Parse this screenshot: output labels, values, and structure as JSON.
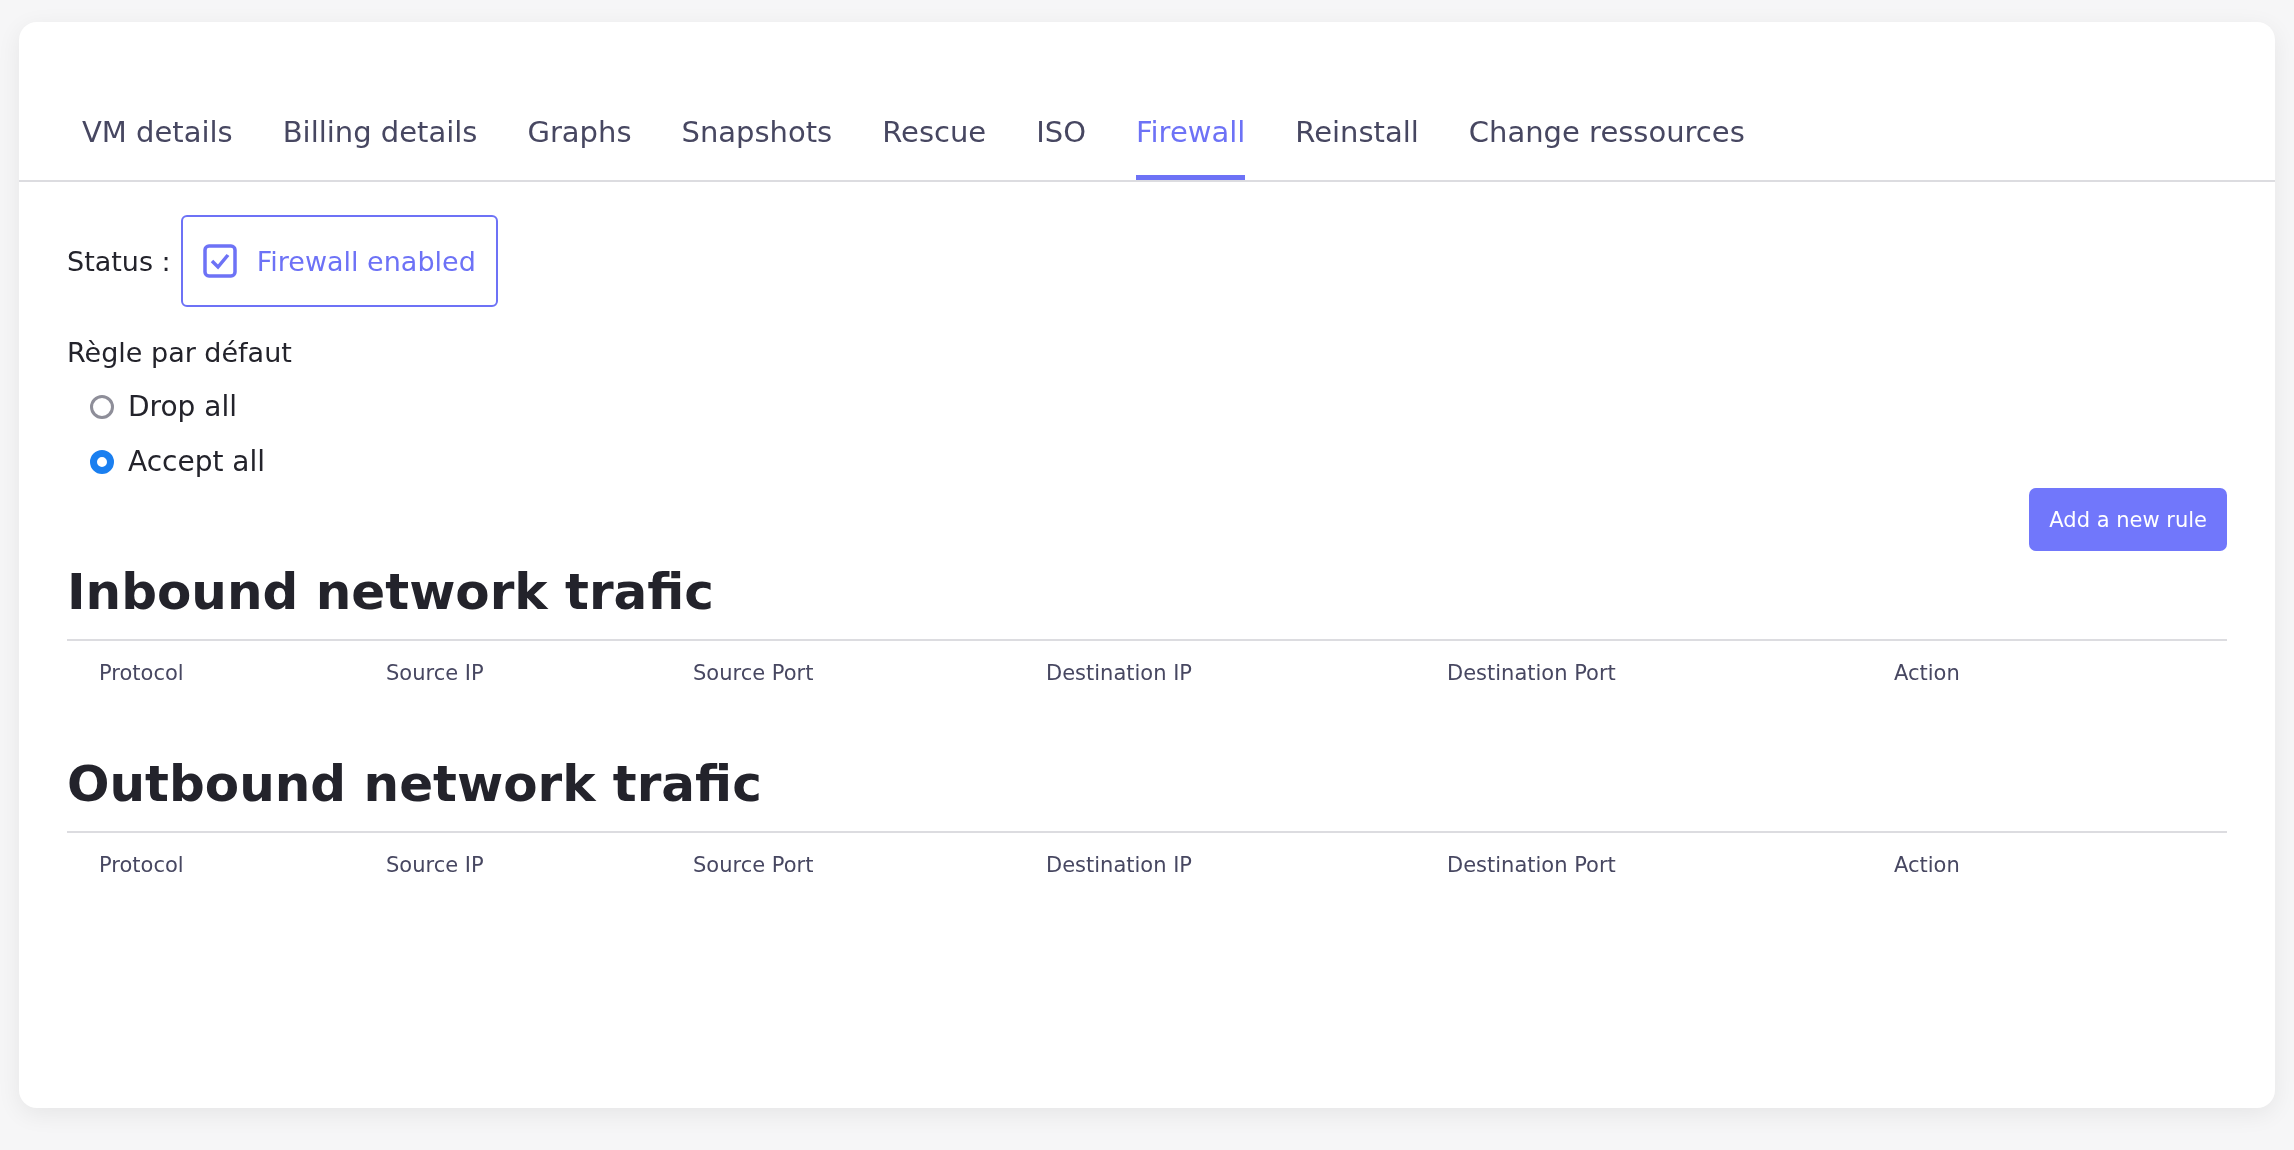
{
  "tabs": [
    {
      "label": "VM details",
      "selected": false
    },
    {
      "label": "Billing details",
      "selected": false
    },
    {
      "label": "Graphs",
      "selected": false
    },
    {
      "label": "Snapshots",
      "selected": false
    },
    {
      "label": "Rescue",
      "selected": false
    },
    {
      "label": "ISO",
      "selected": false
    },
    {
      "label": "Firewall",
      "selected": true
    },
    {
      "label": "Reinstall",
      "selected": false
    },
    {
      "label": "Change ressources",
      "selected": false
    }
  ],
  "status": {
    "label": "Status :",
    "toggle": {
      "label": "Firewall enabled",
      "checked": true
    }
  },
  "default_rule": {
    "title": "Règle par défaut",
    "options": [
      {
        "label": "Drop all",
        "selected": false
      },
      {
        "label": "Accept all",
        "selected": true
      }
    ]
  },
  "add_button": "Add a new rule",
  "sections": [
    {
      "title": "Inbound network trafic",
      "columns": [
        "Protocol",
        "Source IP",
        "Source Port",
        "Destination IP",
        "Destination Port",
        "Action"
      ]
    },
    {
      "title": "Outbound network trafic",
      "columns": [
        "Protocol",
        "Source IP",
        "Source Port",
        "Destination IP",
        "Destination Port",
        "Action"
      ]
    }
  ]
}
